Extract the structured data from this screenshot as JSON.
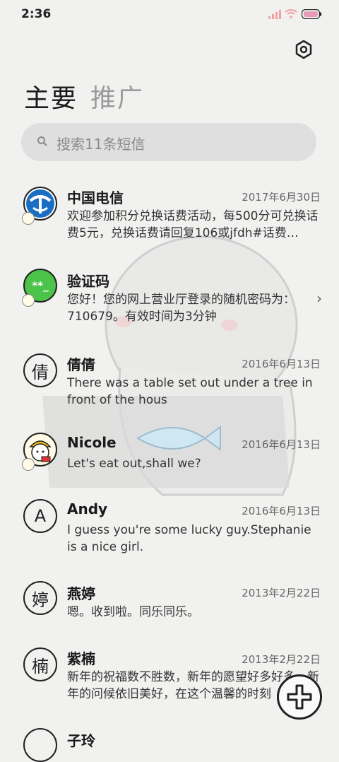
{
  "status": {
    "time": "2:36"
  },
  "tabs": [
    {
      "label": "主要"
    },
    {
      "label": "推广"
    }
  ],
  "search": {
    "placeholder": "搜索11条短信"
  },
  "messages": [
    {
      "name": "中国电信",
      "date": "2017年6月30日",
      "preview": "欢迎参加积分兑换话费活动，每500分可兑换话费5元，兑换话费请回复106或jfdh#话费…",
      "avatar": "telecom-logo"
    },
    {
      "name": "验证码",
      "date": "",
      "preview": "您好！您的网上营业厅登录的随机密码为：710679。有效时间为3分钟",
      "avatar": "**_"
    },
    {
      "name": "倩倩",
      "date": "2016年6月13日",
      "preview": "There was a table set out under a tree in front of the hous",
      "avatar": "倩"
    },
    {
      "name": "Nicole",
      "date": "2016年6月13日",
      "preview": "Let's eat out,shall we?",
      "avatar": "cartoon-face"
    },
    {
      "name": "Andy",
      "date": "2016年6月13日",
      "preview": "I guess you're some lucky guy.Stephanie is a nice girl.",
      "avatar": "A"
    },
    {
      "name": "燕婷",
      "date": "2013年2月22日",
      "preview": "嗯。收到啦。同乐同乐。",
      "avatar": "婷"
    },
    {
      "name": "紫楠",
      "date": "2013年2月22日",
      "preview": "新年的祝福数不胜数，新年的愿望好多好多，新年的问候依旧美好，在这个温馨的时刻",
      "avatar": "楠"
    },
    {
      "name": "子玲",
      "date": "",
      "preview": "",
      "avatar": ""
    }
  ],
  "icons": {
    "settings": "settings-icon",
    "search": "search-icon",
    "compose": "compose-plus-icon",
    "chevron": "chevron-right-icon"
  }
}
